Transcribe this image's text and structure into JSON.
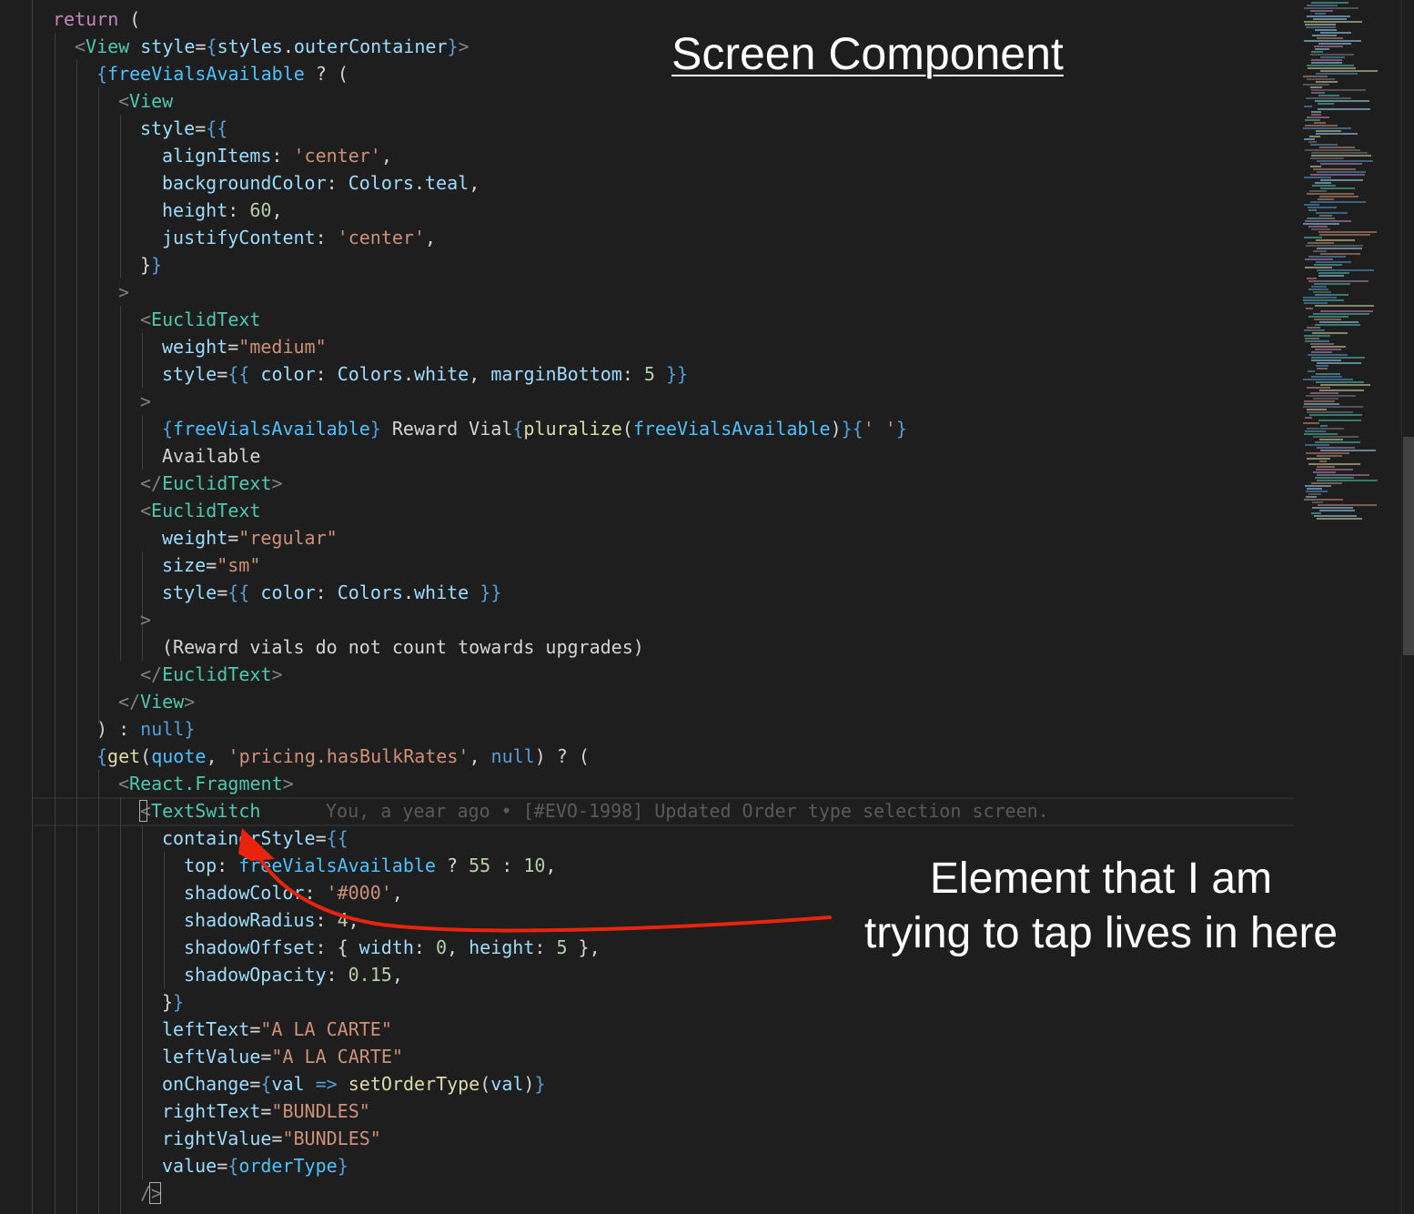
{
  "code_lines": [
    [
      {
        "t": "return",
        "c": "kw"
      },
      {
        "t": " (",
        "c": "text"
      }
    ],
    [
      {
        "t": "<",
        "c": "punc"
      },
      {
        "t": "View",
        "c": "tag"
      },
      {
        "t": " ",
        "c": "text"
      },
      {
        "t": "style",
        "c": "attr"
      },
      {
        "t": "=",
        "c": "text"
      },
      {
        "t": "{",
        "c": "brace"
      },
      {
        "t": "styles",
        "c": "prop"
      },
      {
        "t": ".",
        "c": "text"
      },
      {
        "t": "outerContainer",
        "c": "prop"
      },
      {
        "t": "}",
        "c": "brace"
      },
      {
        "t": ">",
        "c": "punc"
      }
    ],
    [
      {
        "t": "{",
        "c": "brace"
      },
      {
        "t": "freeVialsAvailable",
        "c": "var"
      },
      {
        "t": " ? (",
        "c": "text"
      }
    ],
    [
      {
        "t": "<",
        "c": "punc"
      },
      {
        "t": "View",
        "c": "tag"
      }
    ],
    [
      {
        "t": "style",
        "c": "attr"
      },
      {
        "t": "=",
        "c": "text"
      },
      {
        "t": "{{",
        "c": "brace"
      }
    ],
    [
      {
        "t": "alignItems",
        "c": "prop"
      },
      {
        "t": ": ",
        "c": "text"
      },
      {
        "t": "'center'",
        "c": "str"
      },
      {
        "t": ",",
        "c": "text"
      }
    ],
    [
      {
        "t": "backgroundColor",
        "c": "prop"
      },
      {
        "t": ": ",
        "c": "text"
      },
      {
        "t": "Colors",
        "c": "prop"
      },
      {
        "t": ".",
        "c": "text"
      },
      {
        "t": "teal",
        "c": "prop"
      },
      {
        "t": ",",
        "c": "text"
      }
    ],
    [
      {
        "t": "height",
        "c": "prop"
      },
      {
        "t": ": ",
        "c": "text"
      },
      {
        "t": "60",
        "c": "num"
      },
      {
        "t": ",",
        "c": "text"
      }
    ],
    [
      {
        "t": "justifyContent",
        "c": "prop"
      },
      {
        "t": ": ",
        "c": "text"
      },
      {
        "t": "'center'",
        "c": "str"
      },
      {
        "t": ",",
        "c": "text"
      }
    ],
    [
      {
        "t": "}",
        "c": "text"
      },
      {
        "t": "}",
        "c": "brace"
      }
    ],
    [
      {
        "t": ">",
        "c": "punc"
      }
    ],
    [
      {
        "t": "<",
        "c": "punc"
      },
      {
        "t": "EuclidText",
        "c": "tag"
      }
    ],
    [
      {
        "t": "weight",
        "c": "attr"
      },
      {
        "t": "=",
        "c": "text"
      },
      {
        "t": "\"medium\"",
        "c": "str"
      }
    ],
    [
      {
        "t": "style",
        "c": "attr"
      },
      {
        "t": "=",
        "c": "text"
      },
      {
        "t": "{{",
        "c": "brace"
      },
      {
        "t": " ",
        "c": "text"
      },
      {
        "t": "color",
        "c": "prop"
      },
      {
        "t": ": ",
        "c": "text"
      },
      {
        "t": "Colors",
        "c": "prop"
      },
      {
        "t": ".",
        "c": "text"
      },
      {
        "t": "white",
        "c": "prop"
      },
      {
        "t": ", ",
        "c": "text"
      },
      {
        "t": "marginBottom",
        "c": "prop"
      },
      {
        "t": ": ",
        "c": "text"
      },
      {
        "t": "5",
        "c": "num"
      },
      {
        "t": " ",
        "c": "text"
      },
      {
        "t": "}}",
        "c": "brace"
      }
    ],
    [
      {
        "t": ">",
        "c": "punc"
      }
    ],
    [
      {
        "t": "{",
        "c": "brace"
      },
      {
        "t": "freeVialsAvailable",
        "c": "var"
      },
      {
        "t": "}",
        "c": "brace"
      },
      {
        "t": " Reward Vial",
        "c": "text"
      },
      {
        "t": "{",
        "c": "brace"
      },
      {
        "t": "pluralize",
        "c": "fn"
      },
      {
        "t": "(",
        "c": "text"
      },
      {
        "t": "freeVialsAvailable",
        "c": "var"
      },
      {
        "t": ")",
        "c": "text"
      },
      {
        "t": "}",
        "c": "brace"
      },
      {
        "t": "{",
        "c": "brace"
      },
      {
        "t": "' '",
        "c": "str"
      },
      {
        "t": "}",
        "c": "brace"
      }
    ],
    [
      {
        "t": "Available",
        "c": "text"
      }
    ],
    [
      {
        "t": "</",
        "c": "punc"
      },
      {
        "t": "EuclidText",
        "c": "tag"
      },
      {
        "t": ">",
        "c": "punc"
      }
    ],
    [
      {
        "t": "<",
        "c": "punc"
      },
      {
        "t": "EuclidText",
        "c": "tag"
      }
    ],
    [
      {
        "t": "weight",
        "c": "attr"
      },
      {
        "t": "=",
        "c": "text"
      },
      {
        "t": "\"regular\"",
        "c": "str"
      }
    ],
    [
      {
        "t": "size",
        "c": "attr"
      },
      {
        "t": "=",
        "c": "text"
      },
      {
        "t": "\"sm\"",
        "c": "str"
      }
    ],
    [
      {
        "t": "style",
        "c": "attr"
      },
      {
        "t": "=",
        "c": "text"
      },
      {
        "t": "{{",
        "c": "brace"
      },
      {
        "t": " ",
        "c": "text"
      },
      {
        "t": "color",
        "c": "prop"
      },
      {
        "t": ": ",
        "c": "text"
      },
      {
        "t": "Colors",
        "c": "prop"
      },
      {
        "t": ".",
        "c": "text"
      },
      {
        "t": "white",
        "c": "prop"
      },
      {
        "t": " ",
        "c": "text"
      },
      {
        "t": "}}",
        "c": "brace"
      }
    ],
    [
      {
        "t": ">",
        "c": "punc"
      }
    ],
    [
      {
        "t": "(Reward vials do not count towards upgrades)",
        "c": "text"
      }
    ],
    [
      {
        "t": "</",
        "c": "punc"
      },
      {
        "t": "EuclidText",
        "c": "tag"
      },
      {
        "t": ">",
        "c": "punc"
      }
    ],
    [
      {
        "t": "</",
        "c": "punc"
      },
      {
        "t": "View",
        "c": "tag"
      },
      {
        "t": ">",
        "c": "punc"
      }
    ],
    [
      {
        "t": ") : ",
        "c": "text"
      },
      {
        "t": "null",
        "c": "kwb"
      },
      {
        "t": "}",
        "c": "brace"
      }
    ],
    [
      {
        "t": "{",
        "c": "brace"
      },
      {
        "t": "get",
        "c": "fn"
      },
      {
        "t": "(",
        "c": "text"
      },
      {
        "t": "quote",
        "c": "var"
      },
      {
        "t": ", ",
        "c": "text"
      },
      {
        "t": "'pricing.hasBulkRates'",
        "c": "str"
      },
      {
        "t": ", ",
        "c": "text"
      },
      {
        "t": "null",
        "c": "kwb"
      },
      {
        "t": ") ? (",
        "c": "text"
      }
    ],
    [
      {
        "t": "<",
        "c": "punc"
      },
      {
        "t": "React.Fragment",
        "c": "tag"
      },
      {
        "t": ">",
        "c": "punc"
      }
    ],
    [
      {
        "t": "<",
        "c": "punc"
      },
      {
        "t": "TextSwitch",
        "c": "tag"
      }
    ],
    [
      {
        "t": "containerStyle",
        "c": "attr"
      },
      {
        "t": "=",
        "c": "text"
      },
      {
        "t": "{{",
        "c": "brace"
      }
    ],
    [
      {
        "t": "top",
        "c": "prop"
      },
      {
        "t": ": ",
        "c": "text"
      },
      {
        "t": "freeVialsAvailable",
        "c": "var"
      },
      {
        "t": " ? ",
        "c": "text"
      },
      {
        "t": "55",
        "c": "num"
      },
      {
        "t": " : ",
        "c": "text"
      },
      {
        "t": "10",
        "c": "num"
      },
      {
        "t": ",",
        "c": "text"
      }
    ],
    [
      {
        "t": "shadowColor",
        "c": "prop"
      },
      {
        "t": ": ",
        "c": "text"
      },
      {
        "t": "'#000'",
        "c": "str"
      },
      {
        "t": ",",
        "c": "text"
      }
    ],
    [
      {
        "t": "shadowRadius",
        "c": "prop"
      },
      {
        "t": ": ",
        "c": "text"
      },
      {
        "t": "4",
        "c": "num"
      },
      {
        "t": ",",
        "c": "text"
      }
    ],
    [
      {
        "t": "shadowOffset",
        "c": "prop"
      },
      {
        "t": ": { ",
        "c": "text"
      },
      {
        "t": "width",
        "c": "prop"
      },
      {
        "t": ": ",
        "c": "text"
      },
      {
        "t": "0",
        "c": "num"
      },
      {
        "t": ", ",
        "c": "text"
      },
      {
        "t": "height",
        "c": "prop"
      },
      {
        "t": ": ",
        "c": "text"
      },
      {
        "t": "5",
        "c": "num"
      },
      {
        "t": " },",
        "c": "text"
      }
    ],
    [
      {
        "t": "shadowOpacity",
        "c": "prop"
      },
      {
        "t": ": ",
        "c": "text"
      },
      {
        "t": "0.15",
        "c": "num"
      },
      {
        "t": ",",
        "c": "text"
      }
    ],
    [
      {
        "t": "}",
        "c": "text"
      },
      {
        "t": "}",
        "c": "brace"
      }
    ],
    [
      {
        "t": "leftText",
        "c": "attr"
      },
      {
        "t": "=",
        "c": "text"
      },
      {
        "t": "\"A LA CARTE\"",
        "c": "str"
      }
    ],
    [
      {
        "t": "leftValue",
        "c": "attr"
      },
      {
        "t": "=",
        "c": "text"
      },
      {
        "t": "\"A LA CARTE\"",
        "c": "str"
      }
    ],
    [
      {
        "t": "onChange",
        "c": "attr"
      },
      {
        "t": "=",
        "c": "text"
      },
      {
        "t": "{",
        "c": "brace"
      },
      {
        "t": "val",
        "c": "prop"
      },
      {
        "t": " ",
        "c": "text"
      },
      {
        "t": "=>",
        "c": "kwb"
      },
      {
        "t": " ",
        "c": "text"
      },
      {
        "t": "setOrderType",
        "c": "fn"
      },
      {
        "t": "(",
        "c": "text"
      },
      {
        "t": "val",
        "c": "prop"
      },
      {
        "t": ")",
        "c": "text"
      },
      {
        "t": "}",
        "c": "brace"
      }
    ],
    [
      {
        "t": "rightText",
        "c": "attr"
      },
      {
        "t": "=",
        "c": "text"
      },
      {
        "t": "\"BUNDLES\"",
        "c": "str"
      }
    ],
    [
      {
        "t": "rightValue",
        "c": "attr"
      },
      {
        "t": "=",
        "c": "text"
      },
      {
        "t": "\"BUNDLES\"",
        "c": "str"
      }
    ],
    [
      {
        "t": "value",
        "c": "attr"
      },
      {
        "t": "=",
        "c": "text"
      },
      {
        "t": "{",
        "c": "brace"
      },
      {
        "t": "orderType",
        "c": "var"
      },
      {
        "t": "}",
        "c": "brace"
      }
    ],
    [
      {
        "t": "/>",
        "c": "punc"
      }
    ]
  ],
  "blame_annotation": "You, a year ago • [#EVO-1998] Updated Order type selection screen.",
  "title": "Screen Component",
  "note_line1": "Element that I am",
  "note_line2": "trying to tap lives in here",
  "colors": {
    "background": "#1e1e1e",
    "arrow": "#e8250c",
    "annotation_text": "#ffffff"
  }
}
